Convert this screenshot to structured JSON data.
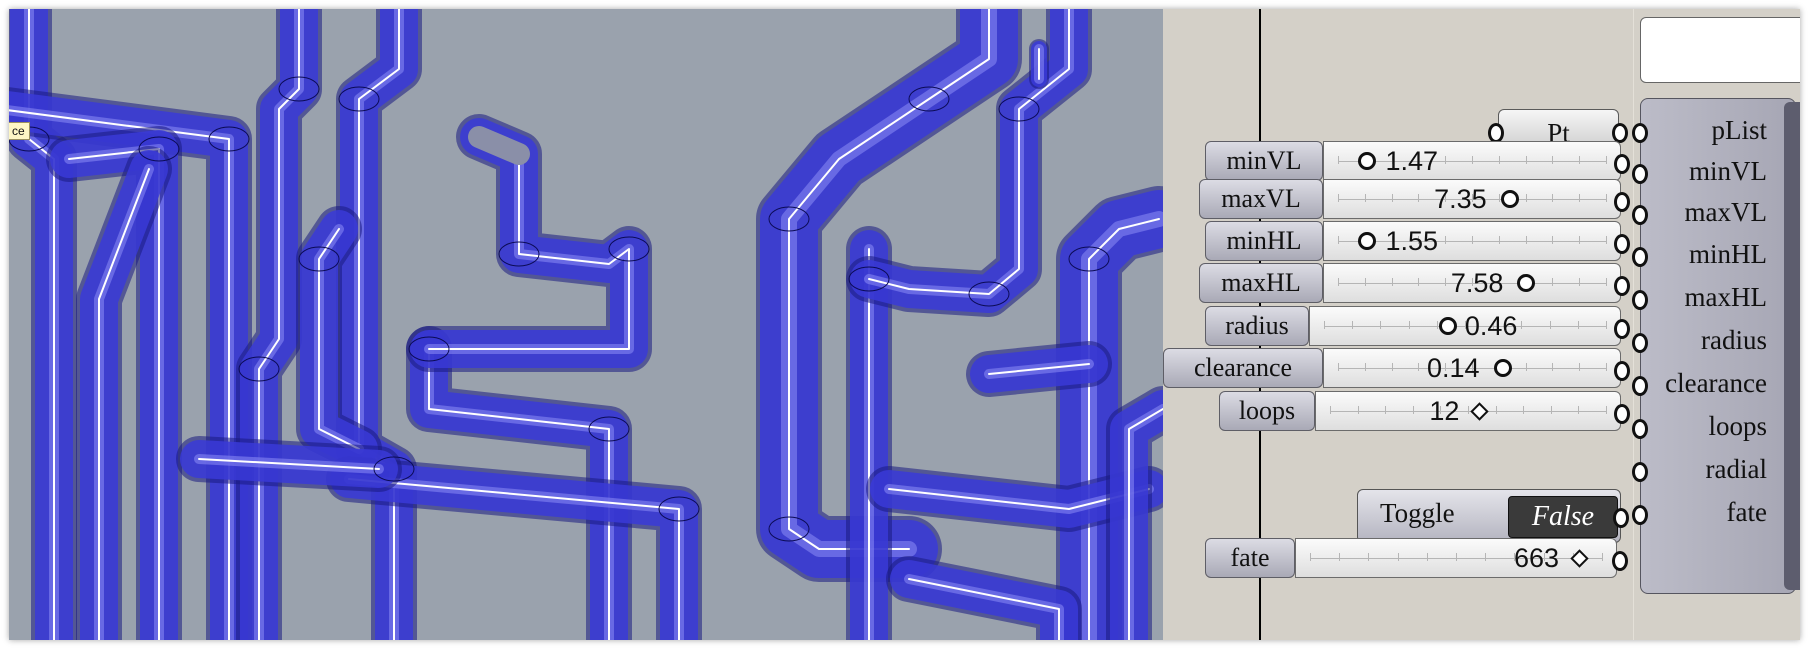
{
  "viewport": {
    "tooltip_text": "ce",
    "pipe_color": "#3a3ad8",
    "background_color": "#9aa2ad"
  },
  "canvas": {
    "pt_chip_label": "Pt",
    "sliders": [
      {
        "label": "minVL",
        "value": "1.47",
        "fraction": 0.04,
        "knob": "circle"
      },
      {
        "label": "maxVL",
        "value": "7.35",
        "fraction": 0.65,
        "knob": "circle"
      },
      {
        "label": "minHL",
        "value": "1.55",
        "fraction": 0.04,
        "knob": "circle"
      },
      {
        "label": "maxHL",
        "value": "7.58",
        "fraction": 0.72,
        "knob": "circle"
      },
      {
        "label": "radius",
        "value": "0.46",
        "fraction": 0.44,
        "knob": "circle"
      },
      {
        "label": "clearance",
        "value": "0.14",
        "fraction": 0.62,
        "knob": "circle"
      },
      {
        "label": "loops",
        "value": "12",
        "fraction": 0.53,
        "knob": "diamond"
      }
    ],
    "toggle": {
      "label": "Toggle",
      "value": "False"
    },
    "fate": {
      "label": "fate",
      "value": "663",
      "fraction": 0.9,
      "knob": "diamond"
    },
    "component_inputs": [
      "pList",
      "minVL",
      "maxVL",
      "minHL",
      "maxHL",
      "radius",
      "clearance",
      "loops",
      "radial",
      "fate"
    ]
  }
}
